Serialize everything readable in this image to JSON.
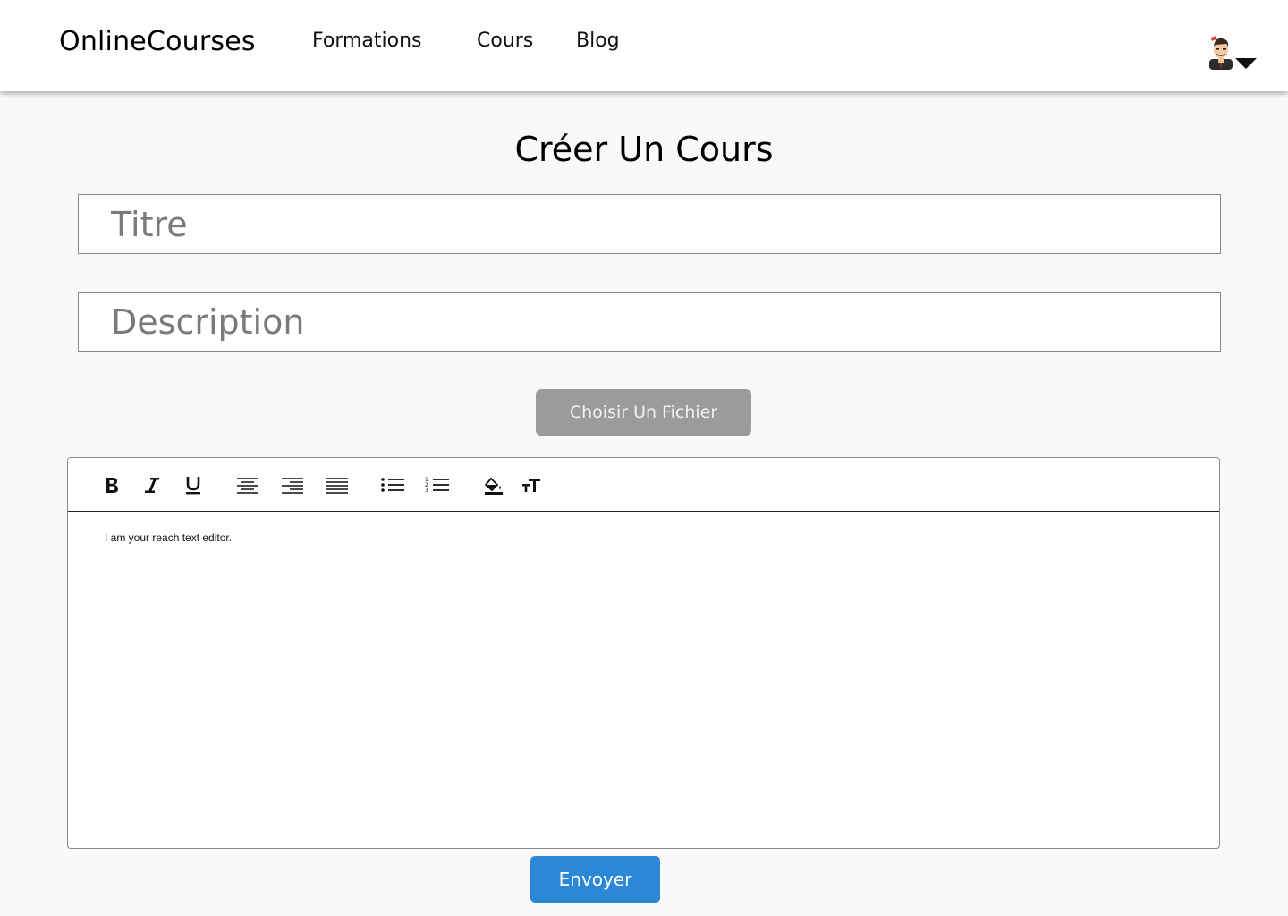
{
  "header": {
    "brand": "OnlineCourses",
    "nav": [
      {
        "label": "Formations"
      },
      {
        "label": "Cours"
      },
      {
        "label": "Blog"
      }
    ],
    "user_menu": {
      "avatar_icon": "user-avatar-icon",
      "dropdown_icon": "caret-down-icon"
    }
  },
  "main": {
    "title": "Créer Un Cours",
    "title_field": {
      "value": "",
      "placeholder": "Titre"
    },
    "description_field": {
      "value": "",
      "placeholder": "Description"
    },
    "file_button_label": "Choisir Un Fichier",
    "editor": {
      "toolbar": [
        "bold-icon",
        "italic-icon",
        "underline-icon",
        "align-center-icon",
        "align-right-icon",
        "align-justify-icon",
        "bullet-list-icon",
        "numbered-list-icon",
        "fill-color-icon",
        "font-size-icon"
      ],
      "content": "I am your reach text editor."
    },
    "submit_label": "Envoyer"
  },
  "colors": {
    "background": "#f9f9f9",
    "file_button": "#9b9b9b",
    "submit_button": "#2a88d6"
  }
}
